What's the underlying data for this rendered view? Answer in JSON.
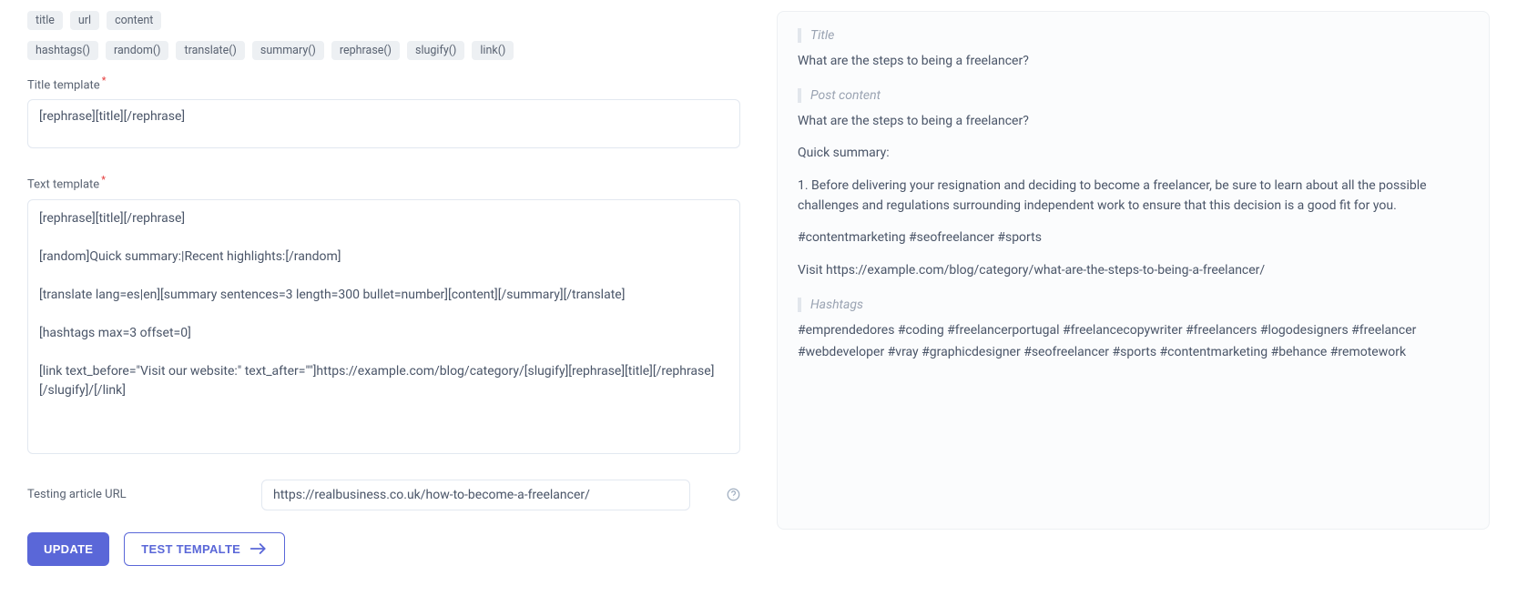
{
  "tagsRow1": [
    "title",
    "url",
    "content"
  ],
  "tagsRow2": [
    "hashtags()",
    "random()",
    "translate()",
    "summary()",
    "rephrase()",
    "slugify()",
    "link()"
  ],
  "labels": {
    "title_template": "Title template",
    "text_template": "Text template",
    "testing_url": "Testing article URL"
  },
  "inputs": {
    "title_template_value": "[rephrase][title][/rephrase]",
    "text_template_value": "[rephrase][title][/rephrase]\n\n[random]Quick summary:|Recent highlights:[/random]\n\n[translate lang=es|en][summary sentences=3 length=300 bullet=number][content][/summary][/translate]\n\n[hashtags max=3 offset=0]\n\n[link text_before=\"Visit our website:\" text_after=\"\"]https://example.com/blog/category/[slugify][rephrase][title][/rephrase][/slugify]/[/link]",
    "testing_url_value": "https://realbusiness.co.uk/how-to-become-a-freelancer/"
  },
  "buttons": {
    "update": "UPDATE",
    "test": "TEST TEMPALTE"
  },
  "preview": {
    "headings": {
      "title": "Title",
      "post_content": "Post content",
      "hashtags": "Hashtags"
    },
    "title_text": "What are the steps to being a freelancer?",
    "pc_line1": "What are the steps to being a freelancer?",
    "pc_summary_label": "Quick summary:",
    "pc_summary_item": "1. Before delivering your resignation and deciding to become a freelancer, be sure to learn about all the possible challenges and regulations surrounding independent work to ensure that this decision is a good fit for you.",
    "pc_hashtags_line": "#contentmarketing #seofreelancer #sports",
    "pc_visit_line": "Visit https://example.com/blog/category/what-are-the-steps-to-being-a-freelancer/",
    "hashtags_line1": "#emprendedores #coding #freelancerportugal #freelancecopywriter #freelancers #logodesigners #freelancer",
    "hashtags_line2": "#webdeveloper #vray #graphicdesigner #seofreelancer #sports #contentmarketing #behance #remotework"
  }
}
